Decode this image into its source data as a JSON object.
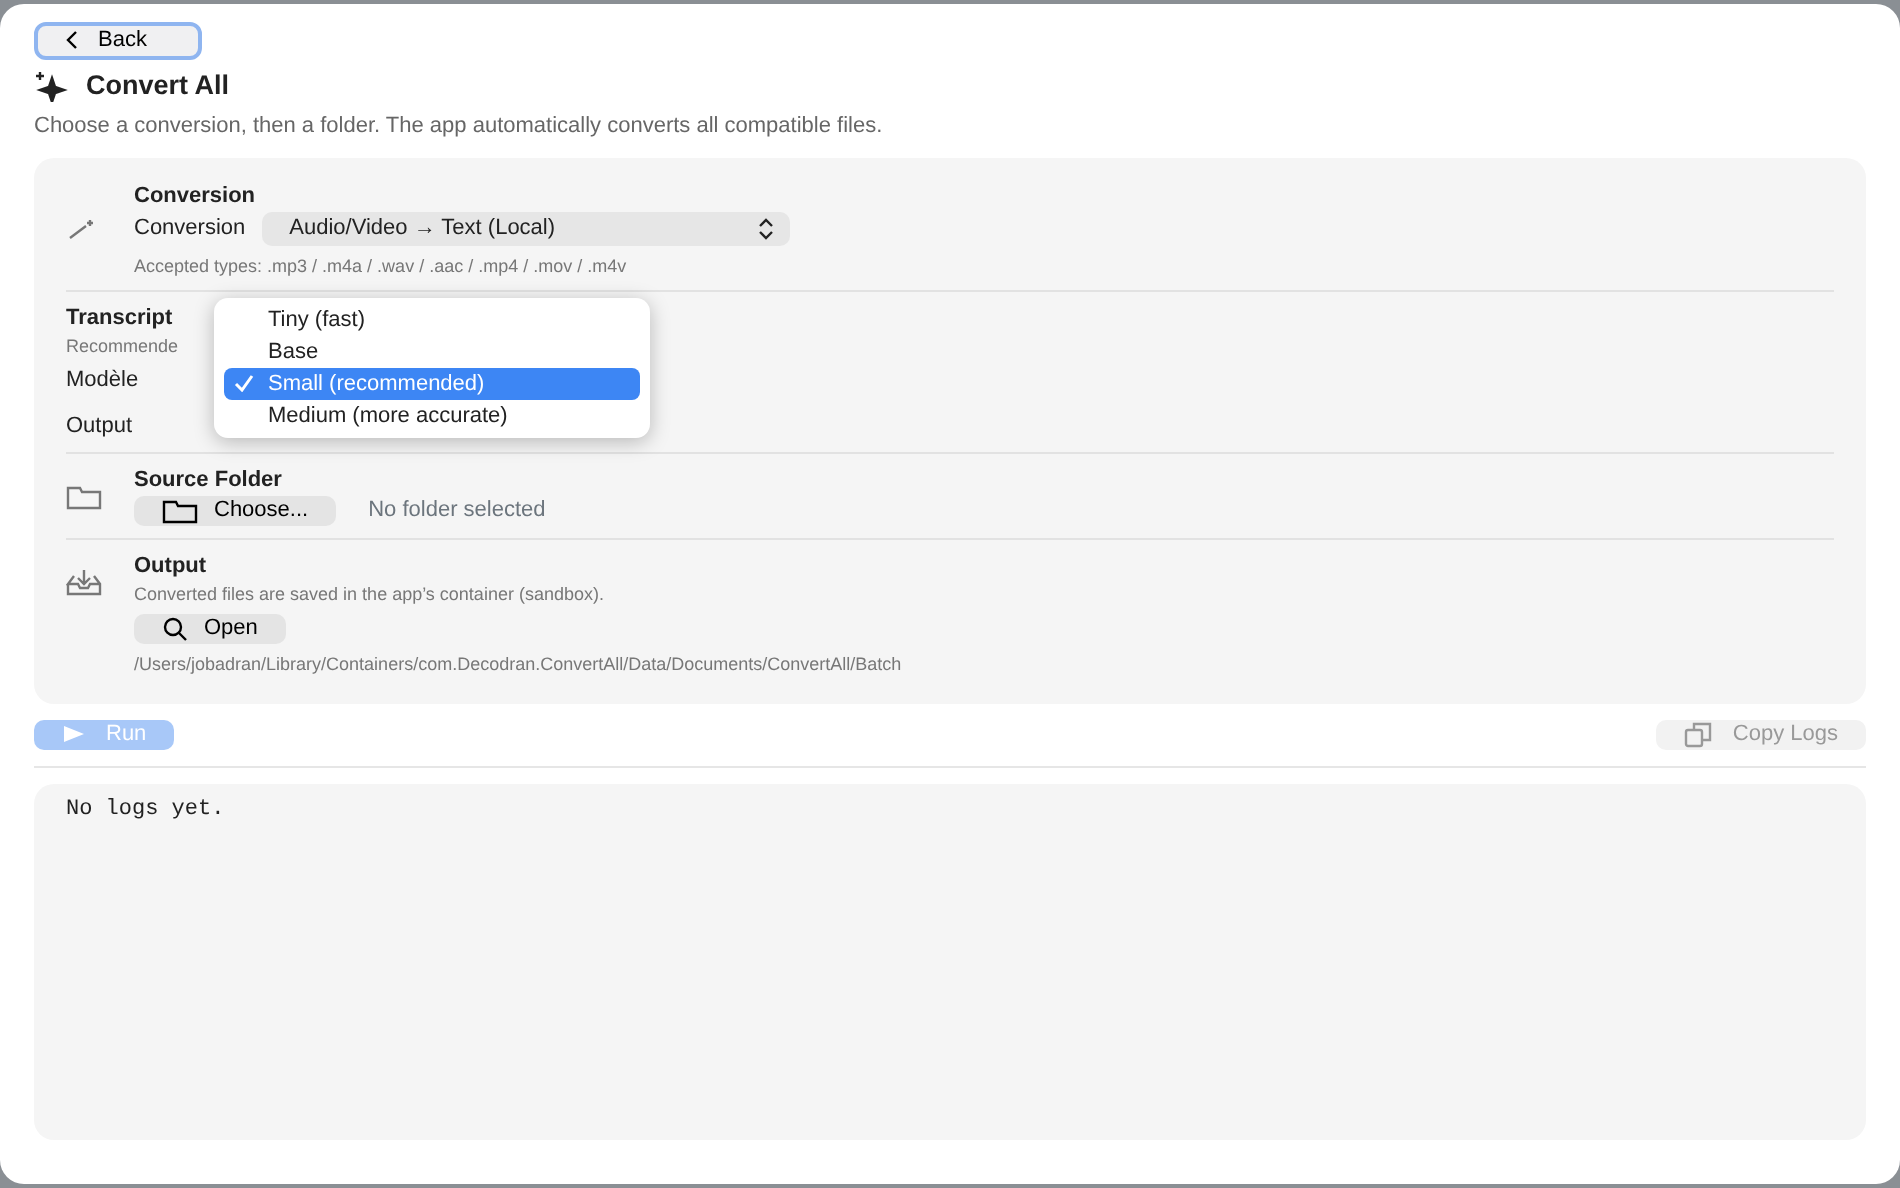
{
  "back_button": {
    "label": "Back"
  },
  "header": {
    "title": "Convert All",
    "subtitle": "Choose a conversion, then a folder. The app automatically converts all compatible files."
  },
  "conversion": {
    "heading": "Conversion",
    "label": "Conversion",
    "value": "Audio/Video → Text (Local)",
    "accepted": "Accepted types: .mp3 / .m4a / .wav / .aac / .mp4 / .mov / .m4v"
  },
  "transcript": {
    "heading": "Transcript",
    "note": "Recommende",
    "model_label": "Modèle",
    "output_label": "Output"
  },
  "model_menu": [
    {
      "label": "Tiny (fast)",
      "selected": false
    },
    {
      "label": "Base",
      "selected": false
    },
    {
      "label": "Small (recommended)",
      "selected": true
    },
    {
      "label": "Medium (more accurate)",
      "selected": false
    }
  ],
  "source_folder": {
    "heading": "Source Folder",
    "button": "Choose...",
    "status": "No folder selected"
  },
  "output": {
    "heading": "Output",
    "note": "Converted files are saved in the app’s container (sandbox).",
    "button": "Open",
    "path": "/Users/jobadran/Library/Containers/com.Decodran.ConvertAll/Data/Documents/ConvertAll/Batch"
  },
  "run_button": {
    "label": "Run",
    "disabled": true
  },
  "copy_logs_button": {
    "label": "Copy Logs",
    "disabled": true
  },
  "logs": {
    "text": "No logs yet."
  }
}
